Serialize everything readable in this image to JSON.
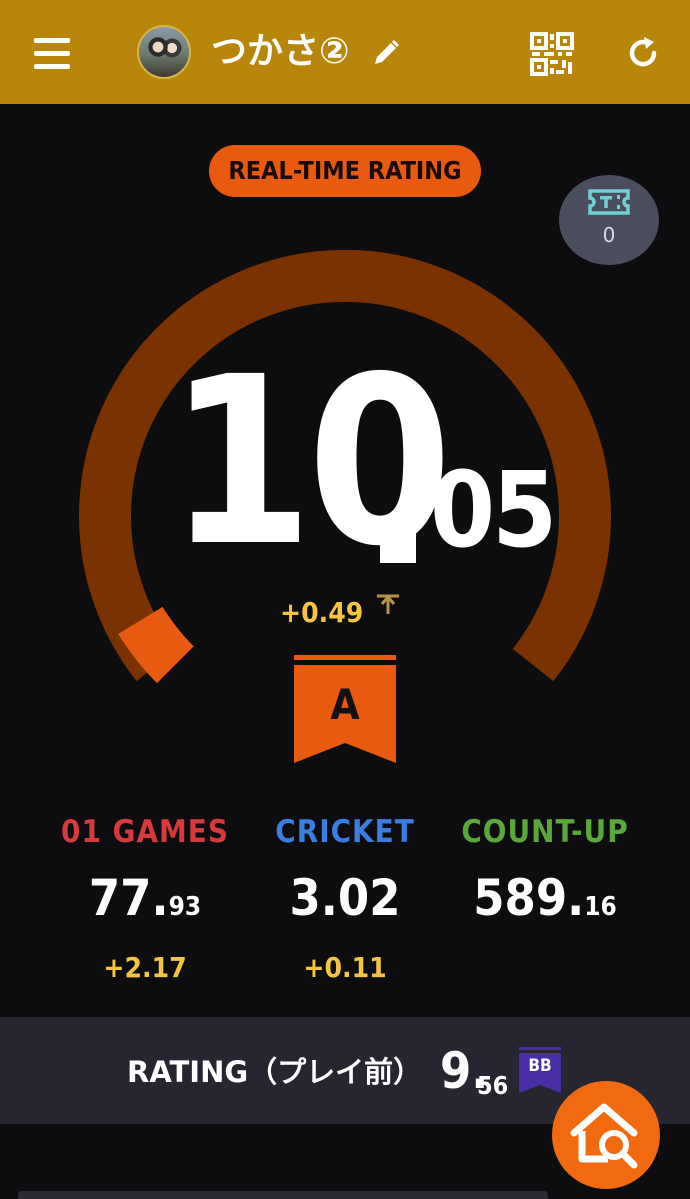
{
  "header": {
    "username": "つかさ②",
    "bg_color": "#b8860b"
  },
  "rating_badge": {
    "label": "REAL-TIME RATING",
    "color": "#e85a10"
  },
  "ticket": {
    "count": "0"
  },
  "realtime_rating": {
    "integer": "10",
    "decimal": "05",
    "delta": "+0.49",
    "gauge_level_fraction": 0.05,
    "class_letter": "A",
    "class_color": "#e85a10"
  },
  "stats": [
    {
      "label": "01 GAMES",
      "value_int": "77.",
      "value_dec": "93",
      "delta": "+2.17",
      "color": "#d63a3a"
    },
    {
      "label": "CRICKET",
      "value_int": "3.02",
      "value_dec": "",
      "delta": "+0.11",
      "color": "#3a7fe0"
    },
    {
      "label": "COUNT-UP",
      "value_int": "589.",
      "value_dec": "16",
      "delta": "",
      "color": "#5aa83a"
    }
  ],
  "previous_rating": {
    "label": "RATING（プレイ前）",
    "integer": "9.",
    "decimal": "56",
    "class_badge": "BB",
    "class_color": "#4a2ea8"
  },
  "icons": {
    "menu": "hamburger-icon",
    "edit": "pencil-icon",
    "qr": "qr-code-icon",
    "refresh": "refresh-icon",
    "ticket": "ticket-icon",
    "trend": "up-arrow-icon",
    "fab": "home-search-icon"
  }
}
